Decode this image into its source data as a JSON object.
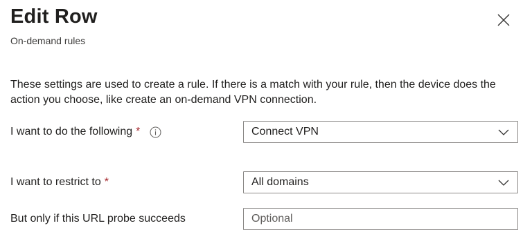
{
  "header": {
    "title": "Edit Row",
    "subtitle": "On-demand rules"
  },
  "description": "These settings are used to create a rule. If there is a match with your rule, then the device does the action you choose, like create an on-demand VPN connection.",
  "fields": {
    "action": {
      "label": "I want to do the following",
      "required_mark": "*",
      "value": "Connect VPN"
    },
    "restrict": {
      "label": "I want to restrict to",
      "required_mark": "*",
      "value": "All domains"
    },
    "url_probe": {
      "label": "But only if this URL probe succeeds",
      "value": "",
      "placeholder": "Optional"
    }
  },
  "colors": {
    "required": "#a4262c",
    "border": "#8a8886",
    "text": "#201f1e"
  },
  "icons": {
    "close": "close-icon",
    "info": "info-icon",
    "chevron": "chevron-down-icon"
  }
}
